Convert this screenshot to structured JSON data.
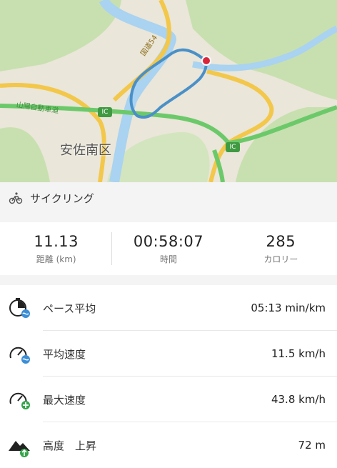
{
  "map": {
    "district_label": "安佐南区",
    "highway_label": "山陽自動車道",
    "road_label": "国道54",
    "interchange_badges": [
      "IC",
      "IC"
    ]
  },
  "activity": {
    "icon": "bicycle-icon",
    "label": "サイクリング"
  },
  "summary": {
    "distance": {
      "value": "11.13",
      "label": "距離 (km)"
    },
    "time": {
      "value": "00:58:07",
      "label": "時間"
    },
    "calories": {
      "value": "285",
      "label": "カロリー"
    }
  },
  "stats": [
    {
      "icon": "pace-icon",
      "name": "ペース平均",
      "value": "05:13 min/km"
    },
    {
      "icon": "average-speed-icon",
      "name": "平均速度",
      "value": "11.5 km/h"
    },
    {
      "icon": "max-speed-icon",
      "name": "最大速度",
      "value": "43.8 km/h"
    },
    {
      "icon": "elevation-gain-icon",
      "name": "高度　上昇",
      "value": "72 m"
    }
  ],
  "colors": {
    "route": "#4a90c8",
    "endpoint": "#d9263b",
    "highway": "#6cc96a",
    "road": "#f3c74a",
    "river": "#a9d3f0",
    "forest": "#c8e0b0"
  }
}
